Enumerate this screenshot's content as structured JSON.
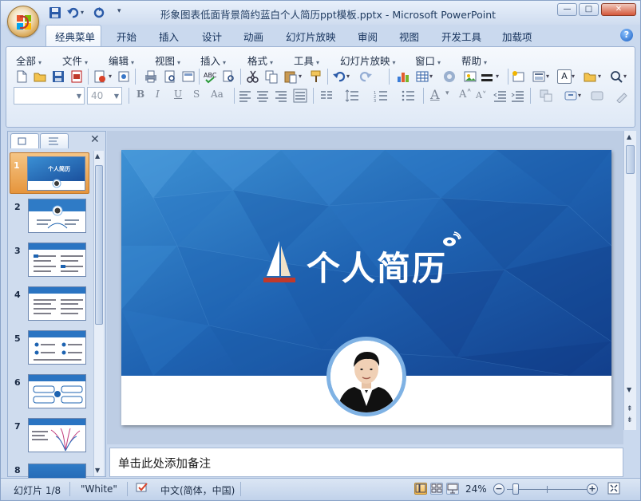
{
  "window": {
    "title": "形象图表低面背景简约蓝白个人简历ppt模板.pptx - Microsoft PowerPoint",
    "minimize": "—",
    "maximize": "□",
    "close": "✕"
  },
  "ribbon_tabs": [
    {
      "label": "经典菜单",
      "active": true
    },
    {
      "label": "开始"
    },
    {
      "label": "插入"
    },
    {
      "label": "设计"
    },
    {
      "label": "动画"
    },
    {
      "label": "幻灯片放映"
    },
    {
      "label": "审阅"
    },
    {
      "label": "视图"
    },
    {
      "label": "开发工具"
    },
    {
      "label": "加载项"
    }
  ],
  "menus": [
    "全部",
    "文件",
    "编辑",
    "视图",
    "插入",
    "格式",
    "工具",
    "幻灯片放映",
    "窗口",
    "帮助"
  ],
  "font": {
    "name": "",
    "size": "40"
  },
  "format_buttons": {
    "bold": "B",
    "italic": "I",
    "underline": "U",
    "shadow": "S",
    "change_case": "Aa",
    "font_color": "A",
    "text_box": "A"
  },
  "slides": [
    {
      "number": "1",
      "thumb_title": "个人简历",
      "selected": true
    },
    {
      "number": "2"
    },
    {
      "number": "3"
    },
    {
      "number": "4"
    },
    {
      "number": "5"
    },
    {
      "number": "6"
    },
    {
      "number": "7"
    },
    {
      "number": "8"
    }
  ],
  "slide": {
    "title": "个人简历"
  },
  "notes": {
    "placeholder": "单击此处添加备注"
  },
  "status": {
    "slide_info": "幻灯片 1/8",
    "theme": "\"White\"",
    "language": "中文(简体，中国)",
    "zoom": "24%",
    "zoom_fraction": 0.24
  },
  "colors": {
    "slide_blue": "#1c5fae",
    "accent_orange": "#e6953c",
    "ribbon_bg": "#dfe9f6"
  }
}
